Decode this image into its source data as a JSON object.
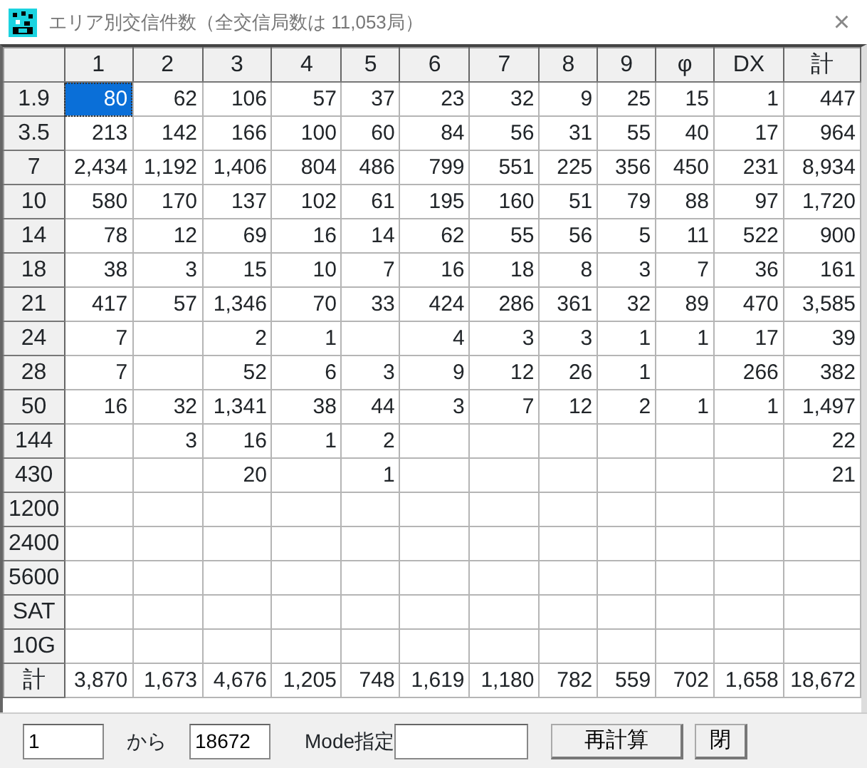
{
  "window": {
    "title": "エリア別交信件数（全交信局数は 11,053局）",
    "close": "×"
  },
  "table": {
    "columns": [
      "1",
      "2",
      "3",
      "4",
      "5",
      "6",
      "7",
      "8",
      "9",
      "φ",
      "DX",
      "計"
    ],
    "rows": [
      {
        "label": "1.9",
        "cells": [
          {
            "text": "80",
            "selected": true
          },
          {
            "text": "62",
            "selected": false
          },
          {
            "text": "106",
            "selected": false
          },
          {
            "text": "57",
            "selected": false
          },
          {
            "text": "37",
            "selected": false
          },
          {
            "text": "23",
            "selected": false
          },
          {
            "text": "32",
            "selected": false
          },
          {
            "text": "9",
            "selected": false
          },
          {
            "text": "25",
            "selected": false
          },
          {
            "text": "15",
            "selected": false
          },
          {
            "text": "1",
            "selected": false
          },
          {
            "text": "447",
            "selected": false
          }
        ]
      },
      {
        "label": "3.5",
        "cells": [
          {
            "text": "213",
            "selected": false
          },
          {
            "text": "142",
            "selected": false
          },
          {
            "text": "166",
            "selected": false
          },
          {
            "text": "100",
            "selected": false
          },
          {
            "text": "60",
            "selected": false
          },
          {
            "text": "84",
            "selected": false
          },
          {
            "text": "56",
            "selected": false
          },
          {
            "text": "31",
            "selected": false
          },
          {
            "text": "55",
            "selected": false
          },
          {
            "text": "40",
            "selected": false
          },
          {
            "text": "17",
            "selected": false
          },
          {
            "text": "964",
            "selected": false
          }
        ]
      },
      {
        "label": "7",
        "cells": [
          {
            "text": "2,434",
            "selected": false
          },
          {
            "text": "1,192",
            "selected": false
          },
          {
            "text": "1,406",
            "selected": false
          },
          {
            "text": "804",
            "selected": false
          },
          {
            "text": "486",
            "selected": false
          },
          {
            "text": "799",
            "selected": false
          },
          {
            "text": "551",
            "selected": false
          },
          {
            "text": "225",
            "selected": false
          },
          {
            "text": "356",
            "selected": false
          },
          {
            "text": "450",
            "selected": false
          },
          {
            "text": "231",
            "selected": false
          },
          {
            "text": "8,934",
            "selected": false
          }
        ]
      },
      {
        "label": "10",
        "cells": [
          {
            "text": "580",
            "selected": false
          },
          {
            "text": "170",
            "selected": false
          },
          {
            "text": "137",
            "selected": false
          },
          {
            "text": "102",
            "selected": false
          },
          {
            "text": "61",
            "selected": false
          },
          {
            "text": "195",
            "selected": false
          },
          {
            "text": "160",
            "selected": false
          },
          {
            "text": "51",
            "selected": false
          },
          {
            "text": "79",
            "selected": false
          },
          {
            "text": "88",
            "selected": false
          },
          {
            "text": "97",
            "selected": false
          },
          {
            "text": "1,720",
            "selected": false
          }
        ]
      },
      {
        "label": "14",
        "cells": [
          {
            "text": "78",
            "selected": false
          },
          {
            "text": "12",
            "selected": false
          },
          {
            "text": "69",
            "selected": false
          },
          {
            "text": "16",
            "selected": false
          },
          {
            "text": "14",
            "selected": false
          },
          {
            "text": "62",
            "selected": false
          },
          {
            "text": "55",
            "selected": false
          },
          {
            "text": "56",
            "selected": false
          },
          {
            "text": "5",
            "selected": false
          },
          {
            "text": "11",
            "selected": false
          },
          {
            "text": "522",
            "selected": false
          },
          {
            "text": "900",
            "selected": false
          }
        ]
      },
      {
        "label": "18",
        "cells": [
          {
            "text": "38",
            "selected": false
          },
          {
            "text": "3",
            "selected": false
          },
          {
            "text": "15",
            "selected": false
          },
          {
            "text": "10",
            "selected": false
          },
          {
            "text": "7",
            "selected": false
          },
          {
            "text": "16",
            "selected": false
          },
          {
            "text": "18",
            "selected": false
          },
          {
            "text": "8",
            "selected": false
          },
          {
            "text": "3",
            "selected": false
          },
          {
            "text": "7",
            "selected": false
          },
          {
            "text": "36",
            "selected": false
          },
          {
            "text": "161",
            "selected": false
          }
        ]
      },
      {
        "label": "21",
        "cells": [
          {
            "text": "417",
            "selected": false
          },
          {
            "text": "57",
            "selected": false
          },
          {
            "text": "1,346",
            "selected": false
          },
          {
            "text": "70",
            "selected": false
          },
          {
            "text": "33",
            "selected": false
          },
          {
            "text": "424",
            "selected": false
          },
          {
            "text": "286",
            "selected": false
          },
          {
            "text": "361",
            "selected": false
          },
          {
            "text": "32",
            "selected": false
          },
          {
            "text": "89",
            "selected": false
          },
          {
            "text": "470",
            "selected": false
          },
          {
            "text": "3,585",
            "selected": false
          }
        ]
      },
      {
        "label": "24",
        "cells": [
          {
            "text": "7",
            "selected": false
          },
          {
            "selected": false
          },
          {
            "text": "2",
            "selected": false
          },
          {
            "text": "1",
            "selected": false
          },
          {
            "selected": false
          },
          {
            "text": "4",
            "selected": false
          },
          {
            "text": "3",
            "selected": false
          },
          {
            "text": "3",
            "selected": false
          },
          {
            "text": "1",
            "selected": false
          },
          {
            "text": "1",
            "selected": false
          },
          {
            "text": "17",
            "selected": false
          },
          {
            "text": "39",
            "selected": false
          }
        ]
      },
      {
        "label": "28",
        "cells": [
          {
            "text": "7",
            "selected": false
          },
          {
            "selected": false
          },
          {
            "text": "52",
            "selected": false
          },
          {
            "text": "6",
            "selected": false
          },
          {
            "text": "3",
            "selected": false
          },
          {
            "text": "9",
            "selected": false
          },
          {
            "text": "12",
            "selected": false
          },
          {
            "text": "26",
            "selected": false
          },
          {
            "text": "1",
            "selected": false
          },
          {
            "selected": false
          },
          {
            "text": "266",
            "selected": false
          },
          {
            "text": "382",
            "selected": false
          }
        ]
      },
      {
        "label": "50",
        "cells": [
          {
            "text": "16",
            "selected": false
          },
          {
            "text": "32",
            "selected": false
          },
          {
            "text": "1,341",
            "selected": false
          },
          {
            "text": "38",
            "selected": false
          },
          {
            "text": "44",
            "selected": false
          },
          {
            "text": "3",
            "selected": false
          },
          {
            "text": "7",
            "selected": false
          },
          {
            "text": "12",
            "selected": false
          },
          {
            "text": "2",
            "selected": false
          },
          {
            "text": "1",
            "selected": false
          },
          {
            "text": "1",
            "selected": false
          },
          {
            "text": "1,497",
            "selected": false
          }
        ]
      },
      {
        "label": "144",
        "cells": [
          {
            "selected": false
          },
          {
            "text": "3",
            "selected": false
          },
          {
            "text": "16",
            "selected": false
          },
          {
            "text": "1",
            "selected": false
          },
          {
            "text": "2",
            "selected": false
          },
          {
            "selected": false
          },
          {
            "selected": false
          },
          {
            "selected": false
          },
          {
            "selected": false
          },
          {
            "selected": false
          },
          {
            "selected": false
          },
          {
            "text": "22",
            "selected": false
          }
        ]
      },
      {
        "label": "430",
        "cells": [
          {
            "selected": false
          },
          {
            "selected": false
          },
          {
            "text": "20",
            "selected": false
          },
          {
            "selected": false
          },
          {
            "text": "1",
            "selected": false
          },
          {
            "selected": false
          },
          {
            "selected": false
          },
          {
            "selected": false
          },
          {
            "selected": false
          },
          {
            "selected": false
          },
          {
            "selected": false
          },
          {
            "text": "21",
            "selected": false
          }
        ]
      },
      {
        "label": "1200",
        "cells": [
          {
            "selected": false
          },
          {
            "selected": false
          },
          {
            "selected": false
          },
          {
            "selected": false
          },
          {
            "selected": false
          },
          {
            "selected": false
          },
          {
            "selected": false
          },
          {
            "selected": false
          },
          {
            "selected": false
          },
          {
            "selected": false
          },
          {
            "selected": false
          },
          {
            "selected": false
          }
        ]
      },
      {
        "label": "2400",
        "cells": [
          {
            "selected": false
          },
          {
            "selected": false
          },
          {
            "selected": false
          },
          {
            "selected": false
          },
          {
            "selected": false
          },
          {
            "selected": false
          },
          {
            "selected": false
          },
          {
            "selected": false
          },
          {
            "selected": false
          },
          {
            "selected": false
          },
          {
            "selected": false
          },
          {
            "selected": false
          }
        ]
      },
      {
        "label": "5600",
        "cells": [
          {
            "selected": false
          },
          {
            "selected": false
          },
          {
            "selected": false
          },
          {
            "selected": false
          },
          {
            "selected": false
          },
          {
            "selected": false
          },
          {
            "selected": false
          },
          {
            "selected": false
          },
          {
            "selected": false
          },
          {
            "selected": false
          },
          {
            "selected": false
          },
          {
            "selected": false
          }
        ]
      },
      {
        "label": "SAT",
        "cells": [
          {
            "selected": false
          },
          {
            "selected": false
          },
          {
            "selected": false
          },
          {
            "selected": false
          },
          {
            "selected": false
          },
          {
            "selected": false
          },
          {
            "selected": false
          },
          {
            "selected": false
          },
          {
            "selected": false
          },
          {
            "selected": false
          },
          {
            "selected": false
          },
          {
            "selected": false
          }
        ]
      },
      {
        "label": "10G",
        "cells": [
          {
            "selected": false
          },
          {
            "selected": false
          },
          {
            "selected": false
          },
          {
            "selected": false
          },
          {
            "selected": false
          },
          {
            "selected": false
          },
          {
            "selected": false
          },
          {
            "selected": false
          },
          {
            "selected": false
          },
          {
            "selected": false
          },
          {
            "selected": false
          },
          {
            "selected": false
          }
        ]
      },
      {
        "label": "計",
        "cells": [
          {
            "text": "3,870",
            "selected": false
          },
          {
            "text": "1,673",
            "selected": false
          },
          {
            "text": "4,676",
            "selected": false
          },
          {
            "text": "1,205",
            "selected": false
          },
          {
            "text": "748",
            "selected": false
          },
          {
            "text": "1,619",
            "selected": false
          },
          {
            "text": "1,180",
            "selected": false
          },
          {
            "text": "782",
            "selected": false
          },
          {
            "text": "559",
            "selected": false
          },
          {
            "text": "702",
            "selected": false
          },
          {
            "text": "1,658",
            "selected": false
          },
          {
            "text": "18,672",
            "selected": false
          }
        ]
      }
    ]
  },
  "footer": {
    "from_value": "1",
    "from_label": "から",
    "to_value": "18672",
    "mode_label": "Mode指定",
    "buttons": [
      "再計算",
      "閉"
    ]
  }
}
